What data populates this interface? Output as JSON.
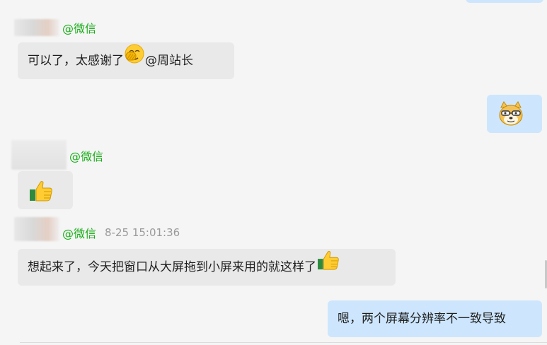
{
  "messages": [
    {
      "sender": "@微信",
      "text": "可以了，太感谢了",
      "mention": "@周站长"
    },
    {
      "sender": "@微信"
    },
    {
      "sender": "@微信",
      "time": "8-25 15:01:36",
      "text": "想起来了，今天把窗口从大屏拖到小屏来用的就这样了"
    },
    {
      "text": "嗯，两个屏幕分辨率不一致导致"
    }
  ],
  "colors": {
    "incoming_bubble": "#e9e9e9",
    "outgoing_bubble": "#cde6fd",
    "sender_name": "#1aad19"
  },
  "icons": [
    "facepalm-emoji",
    "doge-emoji",
    "thumbs-up-emoji"
  ]
}
